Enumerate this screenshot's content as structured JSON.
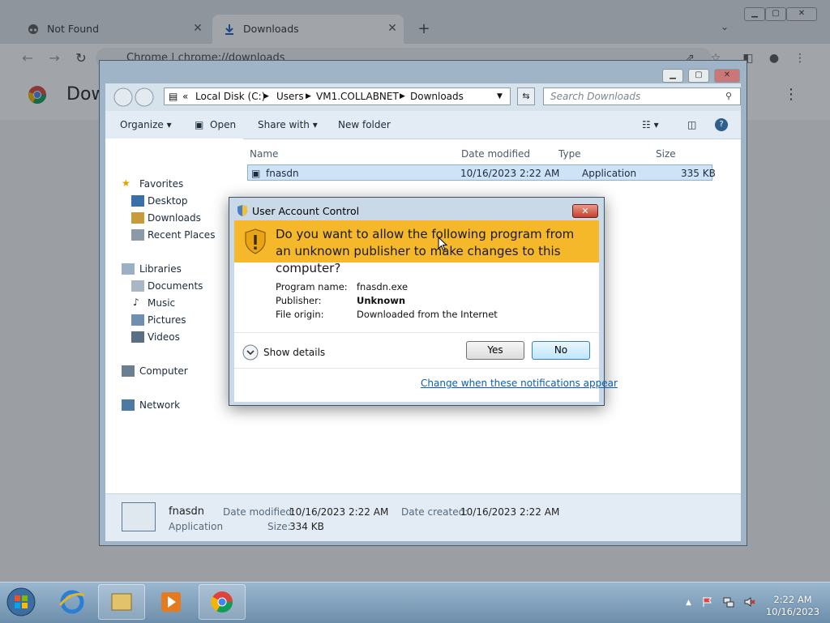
{
  "chrome": {
    "tabs": [
      {
        "label": "Not Found",
        "icon": "incognito-icon",
        "close": "✕"
      },
      {
        "label": "Downloads",
        "icon": "download-icon",
        "close": "✕"
      }
    ],
    "new_tab": "+",
    "address": "Chrome  |  chrome://downloads",
    "page_title": "Downloads",
    "page_title_visible": "Dow"
  },
  "explorer": {
    "breadcrumbs": [
      "«",
      "Local Disk (C:)",
      "Users",
      "VM1.COLLABNET",
      "Downloads"
    ],
    "search_placeholder": "Search Downloads",
    "commands": {
      "organize": "Organize ▾",
      "open": "Open",
      "share_with": "Share with ▾",
      "new_folder": "New folder"
    },
    "nav": {
      "favorites": "Favorites",
      "favorites_items": [
        "Desktop",
        "Downloads",
        "Recent Places"
      ],
      "libraries": "Libraries",
      "libraries_items": [
        "Documents",
        "Music",
        "Pictures",
        "Videos"
      ],
      "computer": "Computer",
      "network": "Network"
    },
    "columns": {
      "name": "Name",
      "date": "Date modified",
      "type": "Type",
      "size": "Size"
    },
    "file": {
      "name": "fnasdn",
      "date": "10/16/2023 2:22 AM",
      "type": "Application",
      "size": "335 KB"
    },
    "details": {
      "name": "fnasdn",
      "type": "Application",
      "date_modified_label": "Date modified:",
      "date_modified": "10/16/2023 2:22 AM",
      "date_created_label": "Date created:",
      "date_created": "10/16/2023 2:22 AM",
      "size_label": "Size:",
      "size": "334 KB"
    }
  },
  "uac": {
    "title": "User Account Control",
    "question": "Do you want to allow the following program from an unknown publisher to make changes to this computer?",
    "program_name_label": "Program name:",
    "program_name": "fnasdn.exe",
    "publisher_label": "Publisher:",
    "publisher": "Unknown",
    "file_origin_label": "File origin:",
    "file_origin": "Downloaded from the Internet",
    "show_details": "Show details",
    "yes": "Yes",
    "no": "No",
    "link": "Change when these notifications appear",
    "close": "✕"
  },
  "taskbar": {
    "time": "2:22 AM",
    "date": "10/16/2023",
    "tray_expand": "▲"
  },
  "colors": {
    "uac_banner": "#f4b82a",
    "link": "#0b5fb0",
    "taskbar": "#7b9bb8"
  }
}
